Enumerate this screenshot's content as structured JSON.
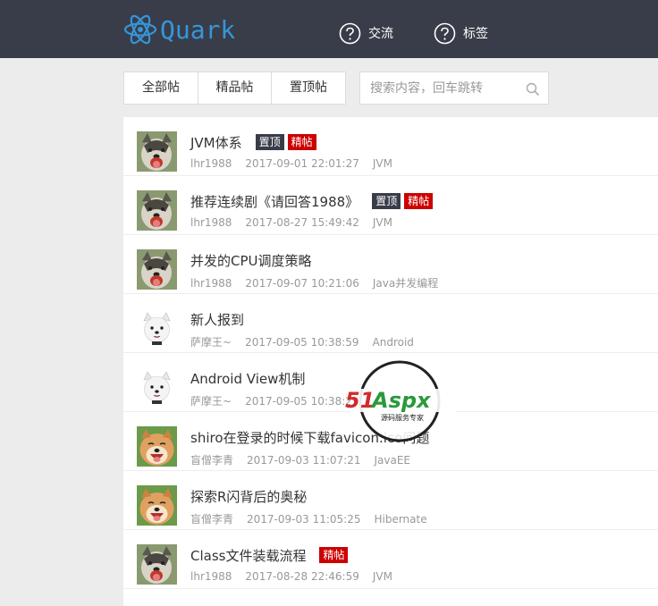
{
  "header": {
    "logo_text": "Quark",
    "nav": [
      {
        "label": "交流",
        "icon": "question-circle-icon"
      },
      {
        "label": "标签",
        "icon": "question-circle-icon"
      }
    ]
  },
  "tabs": [
    {
      "label": "全部帖"
    },
    {
      "label": "精品帖"
    },
    {
      "label": "置顶帖"
    }
  ],
  "search": {
    "placeholder": "搜索内容，回车跳转",
    "icon": "search-icon"
  },
  "posts": [
    {
      "title": "JVM体系",
      "author": "lhr1988",
      "time": "2017-09-01 22:01:27",
      "category": "JVM",
      "avatar": "husky",
      "badges": [
        "置顶",
        "精帖"
      ]
    },
    {
      "title": "推荐连续剧《请回答1988》",
      "author": "lhr1988",
      "time": "2017-08-27 15:49:42",
      "category": "JVM",
      "avatar": "husky",
      "badges": [
        "置顶",
        "精帖"
      ]
    },
    {
      "title": "并发的CPU调度策略",
      "author": "lhr1988",
      "time": "2017-09-07 10:21:06",
      "category": "Java并发编程",
      "avatar": "husky",
      "badges": []
    },
    {
      "title": "新人报到",
      "author": "萨摩王~",
      "time": "2017-09-05 10:38:59",
      "category": "Android",
      "avatar": "samoyed",
      "badges": []
    },
    {
      "title": "Android View机制",
      "author": "萨摩王~",
      "time": "2017-09-05 10:38:27",
      "category": "Android",
      "avatar": "samoyed",
      "badges": []
    },
    {
      "title": "shiro在登录的时候下载favicon.ico问题",
      "author": "盲僧李青",
      "time": "2017-09-03 11:07:21",
      "category": "JavaEE",
      "avatar": "shiba",
      "badges": []
    },
    {
      "title": "探索R闪背后的奥秘",
      "author": "盲僧李青",
      "time": "2017-09-03 11:05:25",
      "category": "Hibernate",
      "avatar": "shiba",
      "badges": []
    },
    {
      "title": "Class文件装载流程",
      "author": "lhr1988",
      "time": "2017-08-28 22:46:59",
      "category": "JVM",
      "avatar": "husky",
      "badges": [
        "精帖"
      ]
    }
  ],
  "watermark": {
    "brand": "51Aspx",
    "tagline": "源码服务专家"
  },
  "colors": {
    "header_bg": "#393d49",
    "accent": "#3596d9",
    "badge_top": "#393d49",
    "badge_good": "#cc0000"
  }
}
